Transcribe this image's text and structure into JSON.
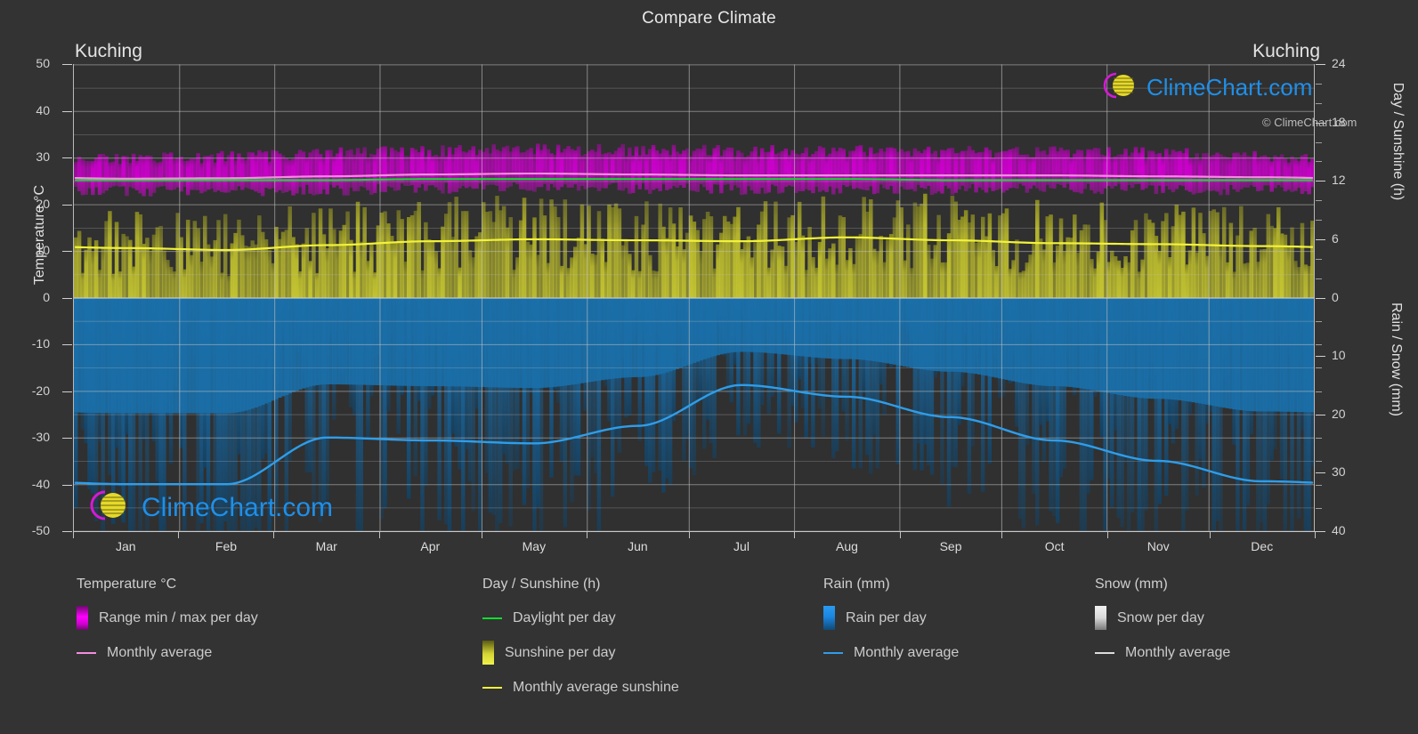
{
  "header": {
    "title": "Compare Climate",
    "location_left": "Kuching",
    "location_right": "Kuching"
  },
  "axes": {
    "left_title": "Temperature °C",
    "right_title_top": "Day / Sunshine (h)",
    "right_title_bottom": "Rain / Snow (mm)",
    "left_ticks": [
      "50",
      "40",
      "30",
      "20",
      "10",
      "0",
      "-10",
      "-20",
      "-30",
      "-40",
      "-50"
    ],
    "right_ticks_top": [
      "24",
      "18",
      "12",
      "6",
      "0"
    ],
    "right_ticks_bottom": [
      "10",
      "20",
      "30",
      "40"
    ],
    "x_ticks": [
      "Jan",
      "Feb",
      "Mar",
      "Apr",
      "May",
      "Jun",
      "Jul",
      "Aug",
      "Sep",
      "Oct",
      "Nov",
      "Dec"
    ]
  },
  "legend": {
    "columns": [
      {
        "heading": "Temperature °C",
        "items": [
          {
            "label": "Range min / max per day",
            "swatch": "gradient-magenta",
            "color": "#e000e0"
          },
          {
            "label": "Monthly average",
            "swatch": "line",
            "color": "#f48ce0"
          }
        ]
      },
      {
        "heading": "Day / Sunshine (h)",
        "items": [
          {
            "label": "Daylight per day",
            "swatch": "line",
            "color": "#0ee02a"
          },
          {
            "label": "Sunshine per day",
            "swatch": "gradient-yellow",
            "color": "#e8e83c"
          },
          {
            "label": "Monthly average sunshine",
            "swatch": "line",
            "color": "#f2f23a"
          }
        ]
      },
      {
        "heading": "Rain (mm)",
        "items": [
          {
            "label": "Rain per day",
            "swatch": "gradient-blue",
            "color": "#1b86e0"
          },
          {
            "label": "Monthly average",
            "swatch": "line",
            "color": "#2f9de8"
          }
        ]
      },
      {
        "heading": "Snow (mm)",
        "items": [
          {
            "label": "Snow per day",
            "swatch": "gradient-white",
            "color": "#e6e6e6"
          },
          {
            "label": "Monthly average",
            "swatch": "line",
            "color": "#dcdcdc"
          }
        ]
      }
    ],
    "credit": "© ClimeChart.com"
  },
  "logo": {
    "text": "ClimeChart.com",
    "arc_color": "#d619d6",
    "sphere_color": "#e5d92a",
    "text_color": "#1f8fe8"
  },
  "colors": {
    "background": "#333333",
    "plot_background": "#303030",
    "grid": "#c2c2c2",
    "temperature": "#d000d0",
    "temperature_avg": "#f48ce0",
    "daylight": "#0ee02a",
    "sunshine": "#cccc30",
    "sunshine_avg": "#f2f23a",
    "rain": "#1b6fa8",
    "rain_avg": "#2f9de8",
    "text": "#d8d8d8"
  },
  "chart_data": {
    "type": "line",
    "title": "Compare Climate",
    "subtitle": "Kuching",
    "xlabel": "",
    "ylabel": "Temperature °C",
    "ylabel_right_top": "Day / Sunshine (h)",
    "ylabel_right_bottom": "Rain / Snow (mm)",
    "ylim": [
      -50,
      50
    ],
    "ylim_right_top": [
      0,
      24
    ],
    "ylim_right_bottom": [
      0,
      40
    ],
    "grid": true,
    "legend_position": "below",
    "categories": [
      "Jan",
      "Feb",
      "Mar",
      "Apr",
      "May",
      "Jun",
      "Jul",
      "Aug",
      "Sep",
      "Oct",
      "Nov",
      "Dec"
    ],
    "series": [
      {
        "name": "Monthly average temperature",
        "unit": "°C",
        "color": "#f48ce0",
        "values": [
          25.5,
          25.6,
          26.0,
          26.4,
          26.6,
          26.4,
          26.2,
          26.2,
          26.2,
          26.2,
          26.0,
          25.8
        ]
      },
      {
        "name": "Daily temperature max",
        "unit": "°C",
        "color": "#d000d0",
        "values": [
          29.6,
          30.0,
          30.8,
          31.4,
          31.6,
          31.5,
          31.3,
          31.3,
          31.2,
          31.2,
          30.9,
          30.2
        ]
      },
      {
        "name": "Daily temperature min",
        "unit": "°C",
        "color": "#d000d0",
        "values": [
          22.8,
          22.8,
          23.0,
          23.4,
          23.6,
          23.4,
          23.2,
          23.2,
          23.2,
          23.2,
          23.2,
          23.0
        ]
      },
      {
        "name": "Daylight per day",
        "unit": "h",
        "color": "#0ee02a",
        "values": [
          12.1,
          12.1,
          12.1,
          12.2,
          12.2,
          12.2,
          12.2,
          12.2,
          12.1,
          12.1,
          12.1,
          12.1
        ]
      },
      {
        "name": "Monthly average sunshine",
        "unit": "h",
        "color": "#f2f23a",
        "values": [
          5.1,
          4.9,
          5.4,
          5.8,
          6.0,
          5.9,
          5.8,
          6.2,
          5.9,
          5.6,
          5.5,
          5.3
        ]
      },
      {
        "name": "Monthly average rain",
        "unit": "mm",
        "color": "#2f9de8",
        "values": [
          32.0,
          32.0,
          24.0,
          24.5,
          25.0,
          22.0,
          15.0,
          17.0,
          20.5,
          24.5,
          28.0,
          31.5
        ]
      },
      {
        "name": "Monthly average snow",
        "unit": "mm",
        "color": "#dcdcdc",
        "values": [
          0,
          0,
          0,
          0,
          0,
          0,
          0,
          0,
          0,
          0,
          0,
          0
        ]
      }
    ],
    "notes": "Daily range bands (magenta = temperature min/max, yellow = sunshine hours, blue = rain per day) are drawn as dense per-day vertical bars."
  }
}
